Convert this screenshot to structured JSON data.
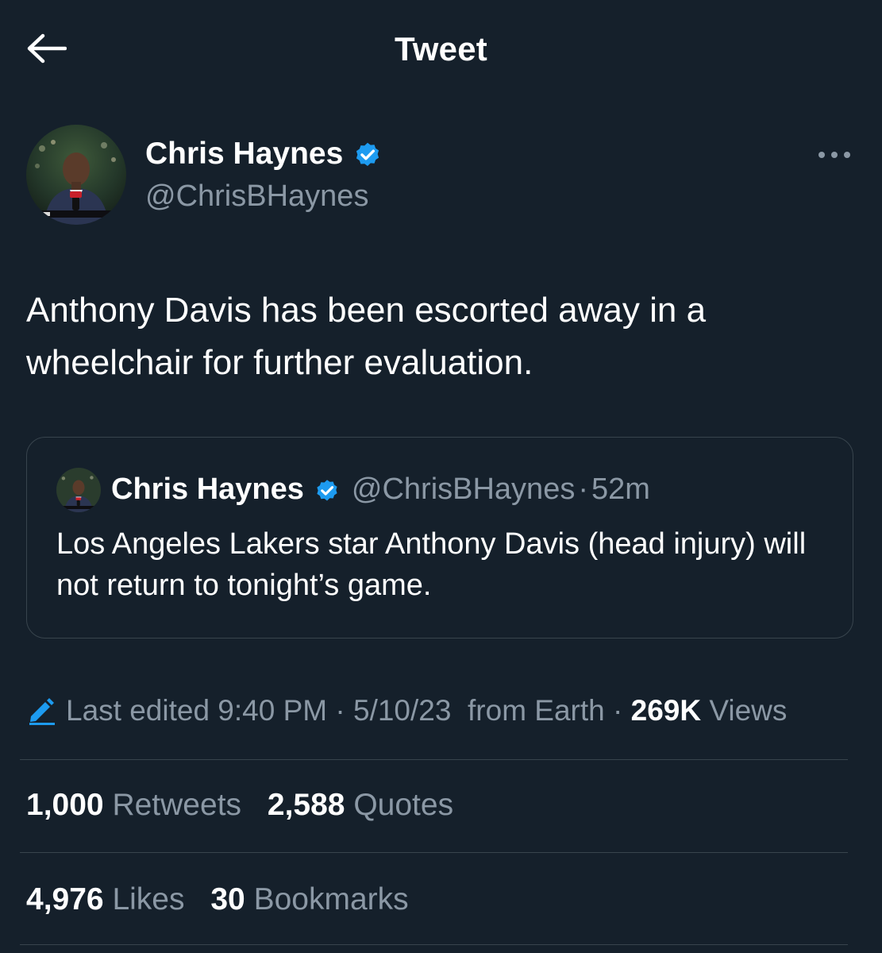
{
  "header": {
    "title": "Tweet",
    "back_icon": "arrow-left-icon"
  },
  "tweet": {
    "author_name": "Chris Haynes",
    "author_handle": "@ChrisBHaynes",
    "verified_icon": "verified-badge-icon",
    "more_icon": "more-horizontal-icon",
    "text": "Anthony Davis has been escorted away in a wheelchair for further evaluation."
  },
  "quote": {
    "author_name": "Chris Haynes",
    "author_handle": "@ChrisBHaynes",
    "separator": "·",
    "time": "52m",
    "text": "Los Angeles Lakers star Anthony Davis (head injury) will not return to tonight’s game."
  },
  "meta": {
    "edit_icon": "pencil-icon",
    "edited_label": "Last edited 9:40 PM",
    "separator": "·",
    "date": "5/10/23",
    "source": "from Earth",
    "views_count": "269K",
    "views_label": "Views"
  },
  "stats": {
    "retweets_count": "1,000",
    "retweets_label": "Retweets",
    "quotes_count": "2,588",
    "quotes_label": "Quotes",
    "likes_count": "4,976",
    "likes_label": "Likes",
    "bookmarks_count": "30",
    "bookmarks_label": "Bookmarks"
  },
  "colors": {
    "background": "#15202b",
    "text_primary": "#ffffff",
    "text_secondary": "#8b98a5",
    "border": "#38444d",
    "accent": "#1d9bf0"
  }
}
